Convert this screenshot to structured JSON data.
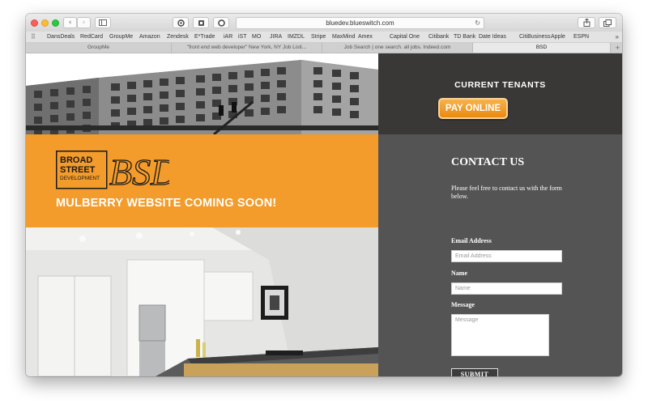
{
  "browser": {
    "url": "bluedev.blueswitch.com",
    "bookmarks": [
      "DansDeals",
      "RedCard",
      "GroupMe",
      "Amazon",
      "Zendesk",
      "E*Trade",
      "iAR",
      "iST",
      "MO",
      "JIRA",
      "IMZDL",
      "Stripe",
      "MaxMind",
      "Amex",
      "Capital One",
      "Citibank",
      "TD Bank",
      "Date Ideas",
      "CitiBusiness",
      "Apple",
      "ESPN"
    ],
    "tabs": [
      {
        "title": "GroupMe"
      },
      {
        "title": "\"front end web developer\" New York, NY Job Listi..."
      },
      {
        "title": "Job Search | one search. all jobs. Indeed.com"
      },
      {
        "title": "BSD",
        "active": true
      }
    ]
  },
  "header": {
    "tenants_label": "CURRENT TENANTS",
    "pay_label": "PAY ONLINE"
  },
  "hero": {
    "logo_lines": [
      "BROAD",
      "STREET",
      "DEVELOPMENT"
    ],
    "logo_mark": "BSD",
    "headline": "MULBERRY WEBSITE COMING SOON!"
  },
  "contact": {
    "title": "CONTACT US",
    "blurb": "Please feel free to contact us with the form below.",
    "email_label": "Email Address",
    "email_placeholder": "Email Address",
    "name_label": "Name",
    "name_placeholder": "Name",
    "message_label": "Message",
    "message_placeholder": "Message",
    "submit_label": "SUBMIT"
  },
  "colors": {
    "accent_orange": "#f39b2b",
    "dark_panel": "#3a3837",
    "form_panel": "#545454"
  }
}
